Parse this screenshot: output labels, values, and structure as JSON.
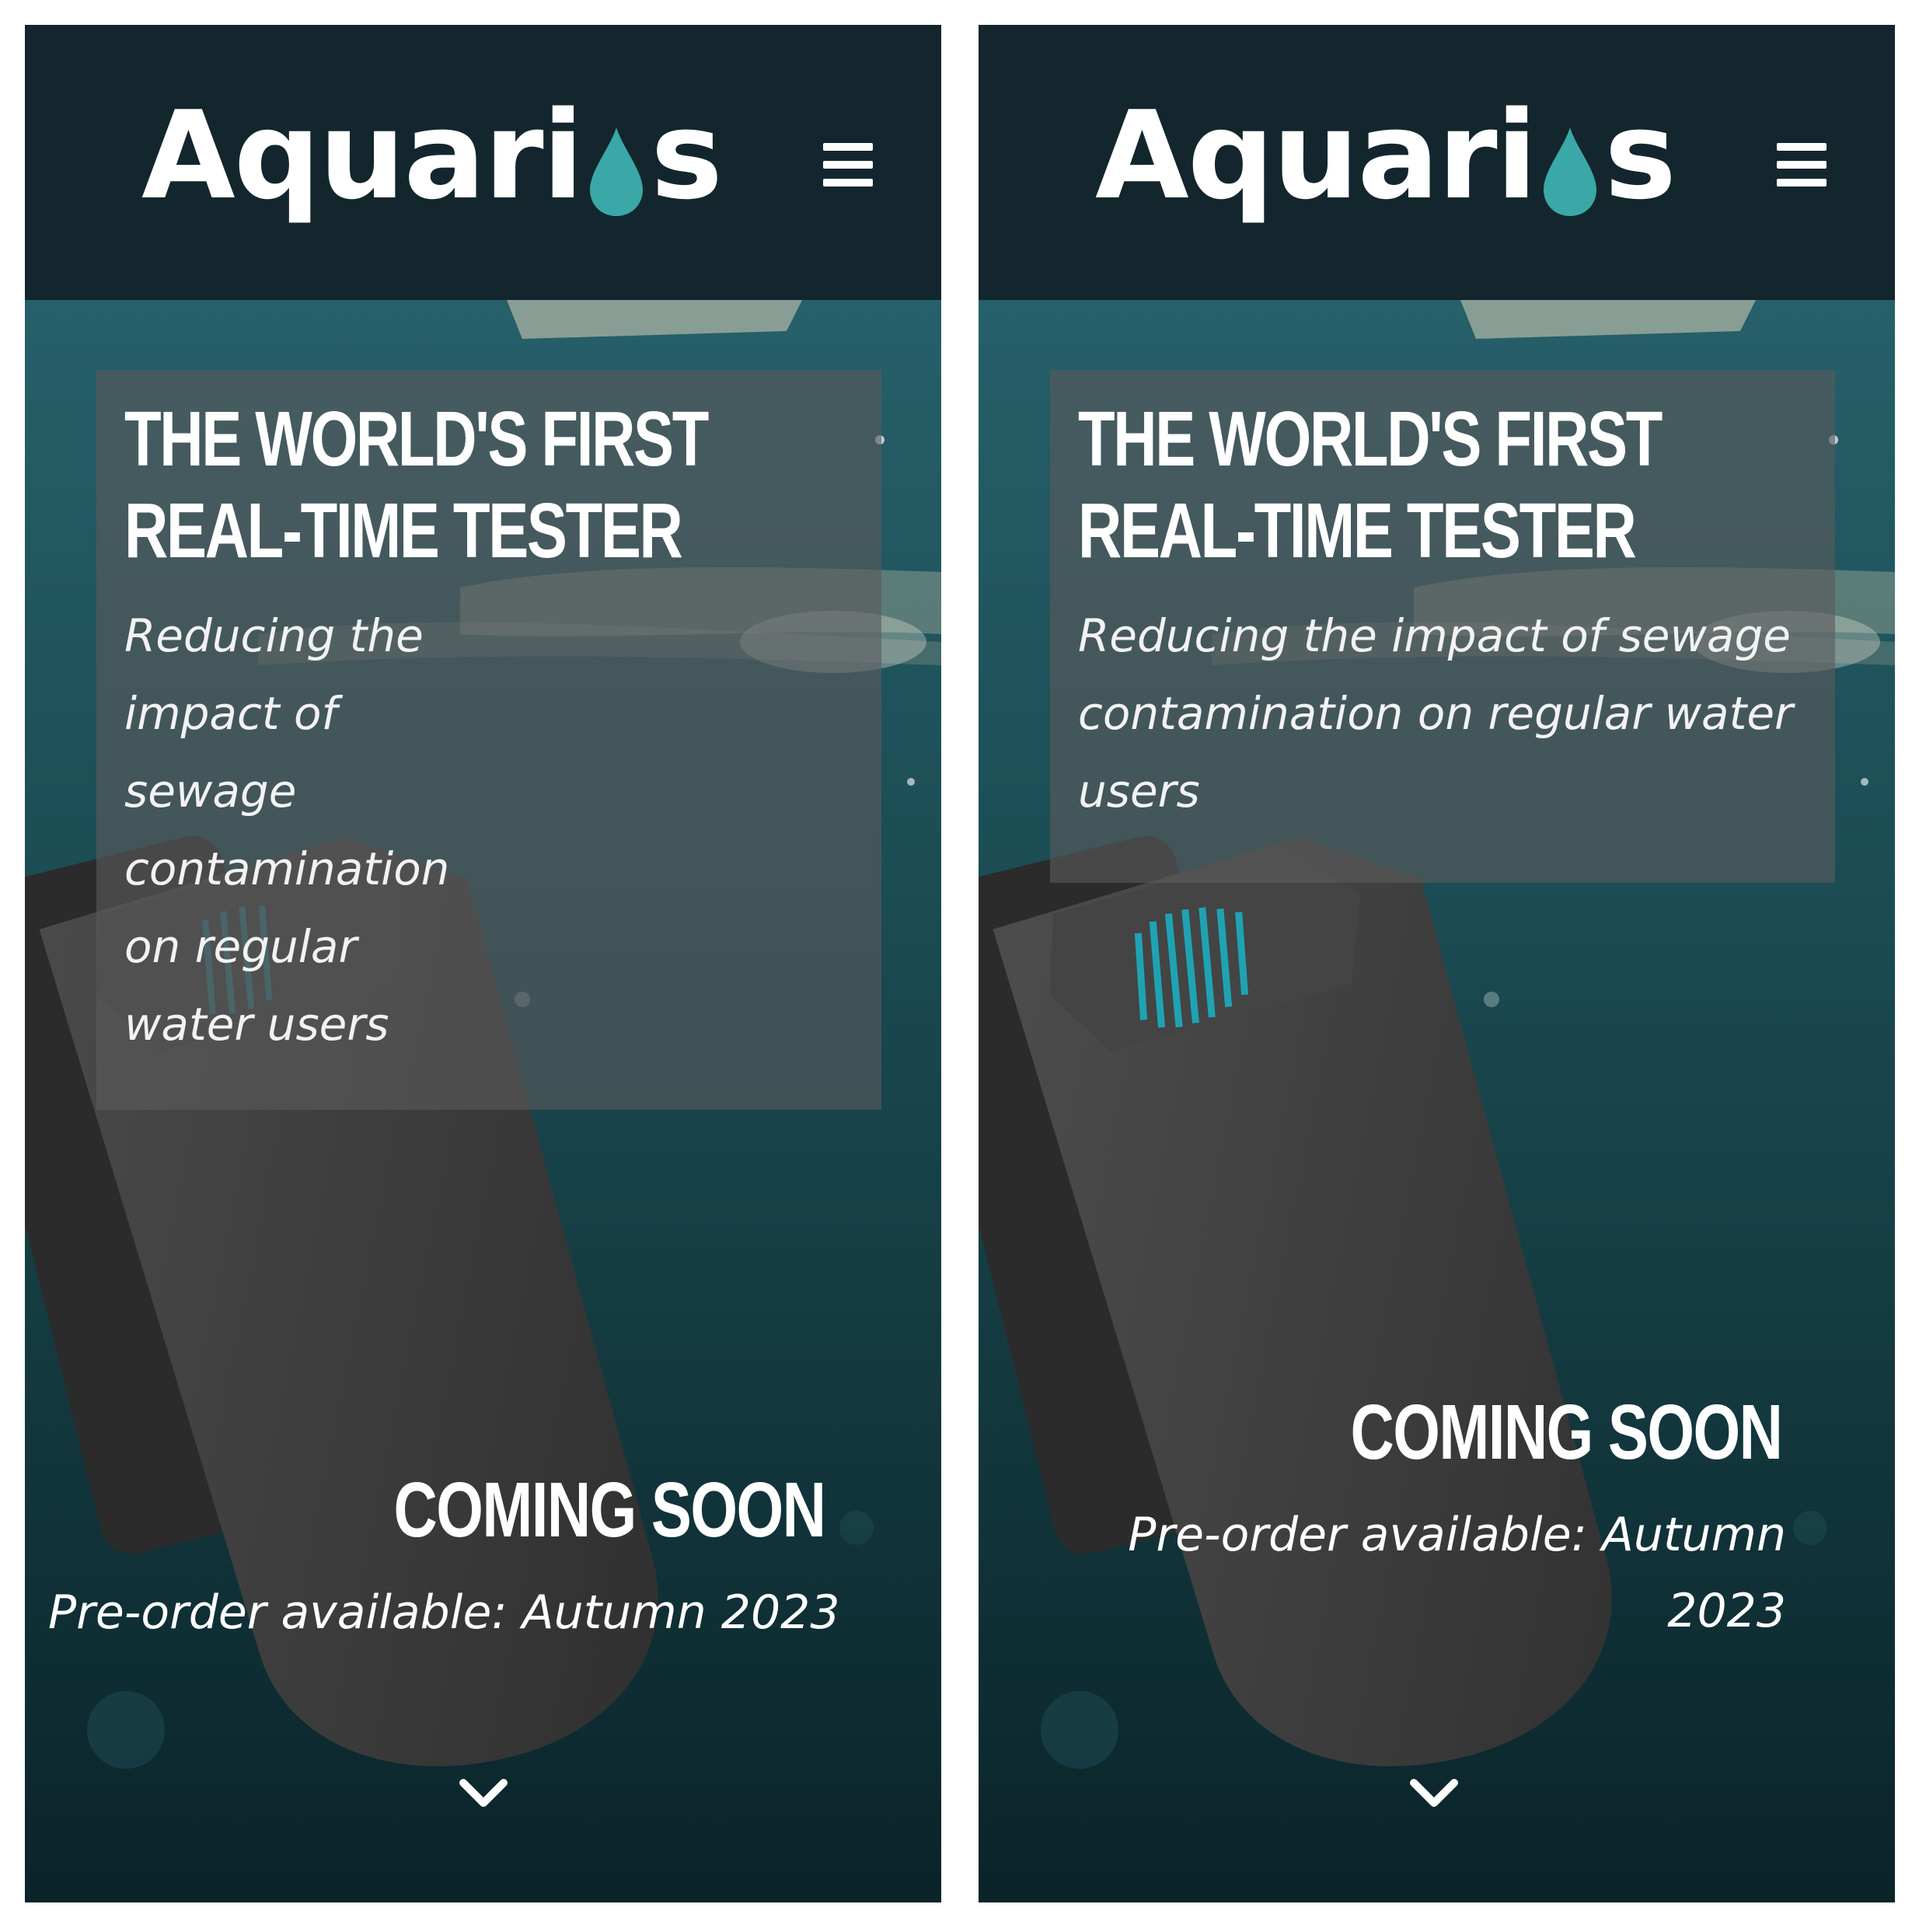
{
  "screens": [
    {
      "brand": {
        "logo_text_start": "Aquari",
        "logo_text_end": "s"
      },
      "hero": {
        "headline": "THE WORLD'S FIRST REAL-TIME TESTER",
        "subline": "Reducing the impact of sewage contamination on regular water users",
        "coming_soon": "COMING SOON",
        "preorder": "Pre-order available: Autumn 2023"
      }
    },
    {
      "brand": {
        "logo_text_start": "Aquari",
        "logo_text_end": "s"
      },
      "hero": {
        "headline": "THE WORLD'S FIRST REAL-TIME TESTER",
        "subline": "Reducing the impact of sewage contamination on regular water users",
        "coming_soon": "COMING SOON",
        "preorder": "Pre-order available: Autumn 2023"
      }
    }
  ],
  "icons": {
    "logo_drop": "water-drop-icon",
    "menu": "hamburger-menu-icon",
    "scroll": "chevron-down-icon"
  },
  "colors": {
    "header_bg": "#13262d",
    "accent_teal": "#3aa8a6",
    "device_stripes": "#1fa3b3",
    "text": "#ffffff"
  }
}
